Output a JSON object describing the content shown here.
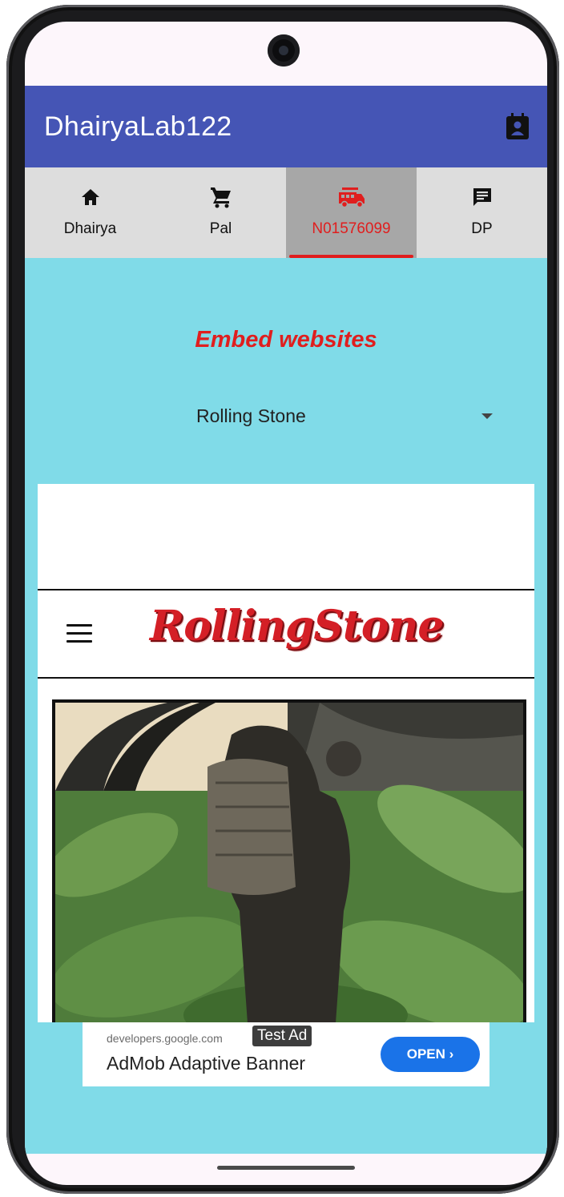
{
  "appbar": {
    "title": "DhairyaLab122"
  },
  "tabs": [
    {
      "label": "Dhairya",
      "icon": "home-icon",
      "active": false
    },
    {
      "label": "Pal",
      "icon": "cart-icon",
      "active": false
    },
    {
      "label": "N01576099",
      "icon": "fire-truck-icon",
      "active": true
    },
    {
      "label": "DP",
      "icon": "chat-icon",
      "active": false
    }
  ],
  "main": {
    "heading": "Embed websites",
    "dropdown_selected": "Rolling Stone"
  },
  "webview": {
    "logo_text": "RollingStone"
  },
  "ad": {
    "domain": "developers.google.com",
    "badge": "Test Ad",
    "title": "AdMob Adaptive Banner",
    "cta": "OPEN ›"
  },
  "colors": {
    "appbar": "#4555b5",
    "accent": "#e01e1e",
    "content_bg": "#80dbe8",
    "tabbar_bg": "#dddddd"
  }
}
